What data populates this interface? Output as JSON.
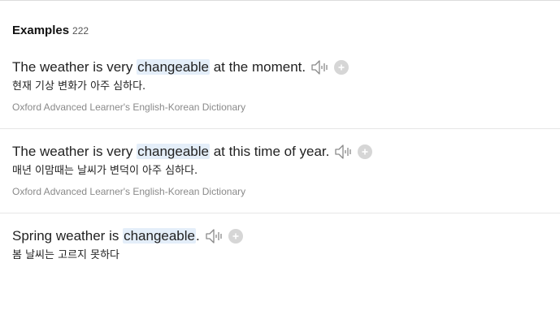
{
  "section": {
    "title": "Examples",
    "count": "222"
  },
  "icons": {
    "speaker": "speaker-icon",
    "add": "plus-circle-icon"
  },
  "colors": {
    "highlight": "#e4eef9",
    "divider": "#e6e6e6",
    "source_text": "#8a8a8a"
  },
  "examples": [
    {
      "before": "The weather is very ",
      "highlight": "changeable",
      "after": " at the moment.",
      "translation": "현재 기상 변화가 아주 심하다.",
      "source": "Oxford Advanced Learner's English-Korean Dictionary"
    },
    {
      "before": "The weather is very ",
      "highlight": "changeable",
      "after": " at this time of year.",
      "translation": "매년 이맘때는 날씨가 변덕이 아주 심하다.",
      "source": "Oxford Advanced Learner's English-Korean Dictionary"
    },
    {
      "before": "Spring weather is ",
      "highlight": "changeable",
      "after": ".",
      "translation": "봄 날씨는 고르지 못하다",
      "source": ""
    }
  ]
}
